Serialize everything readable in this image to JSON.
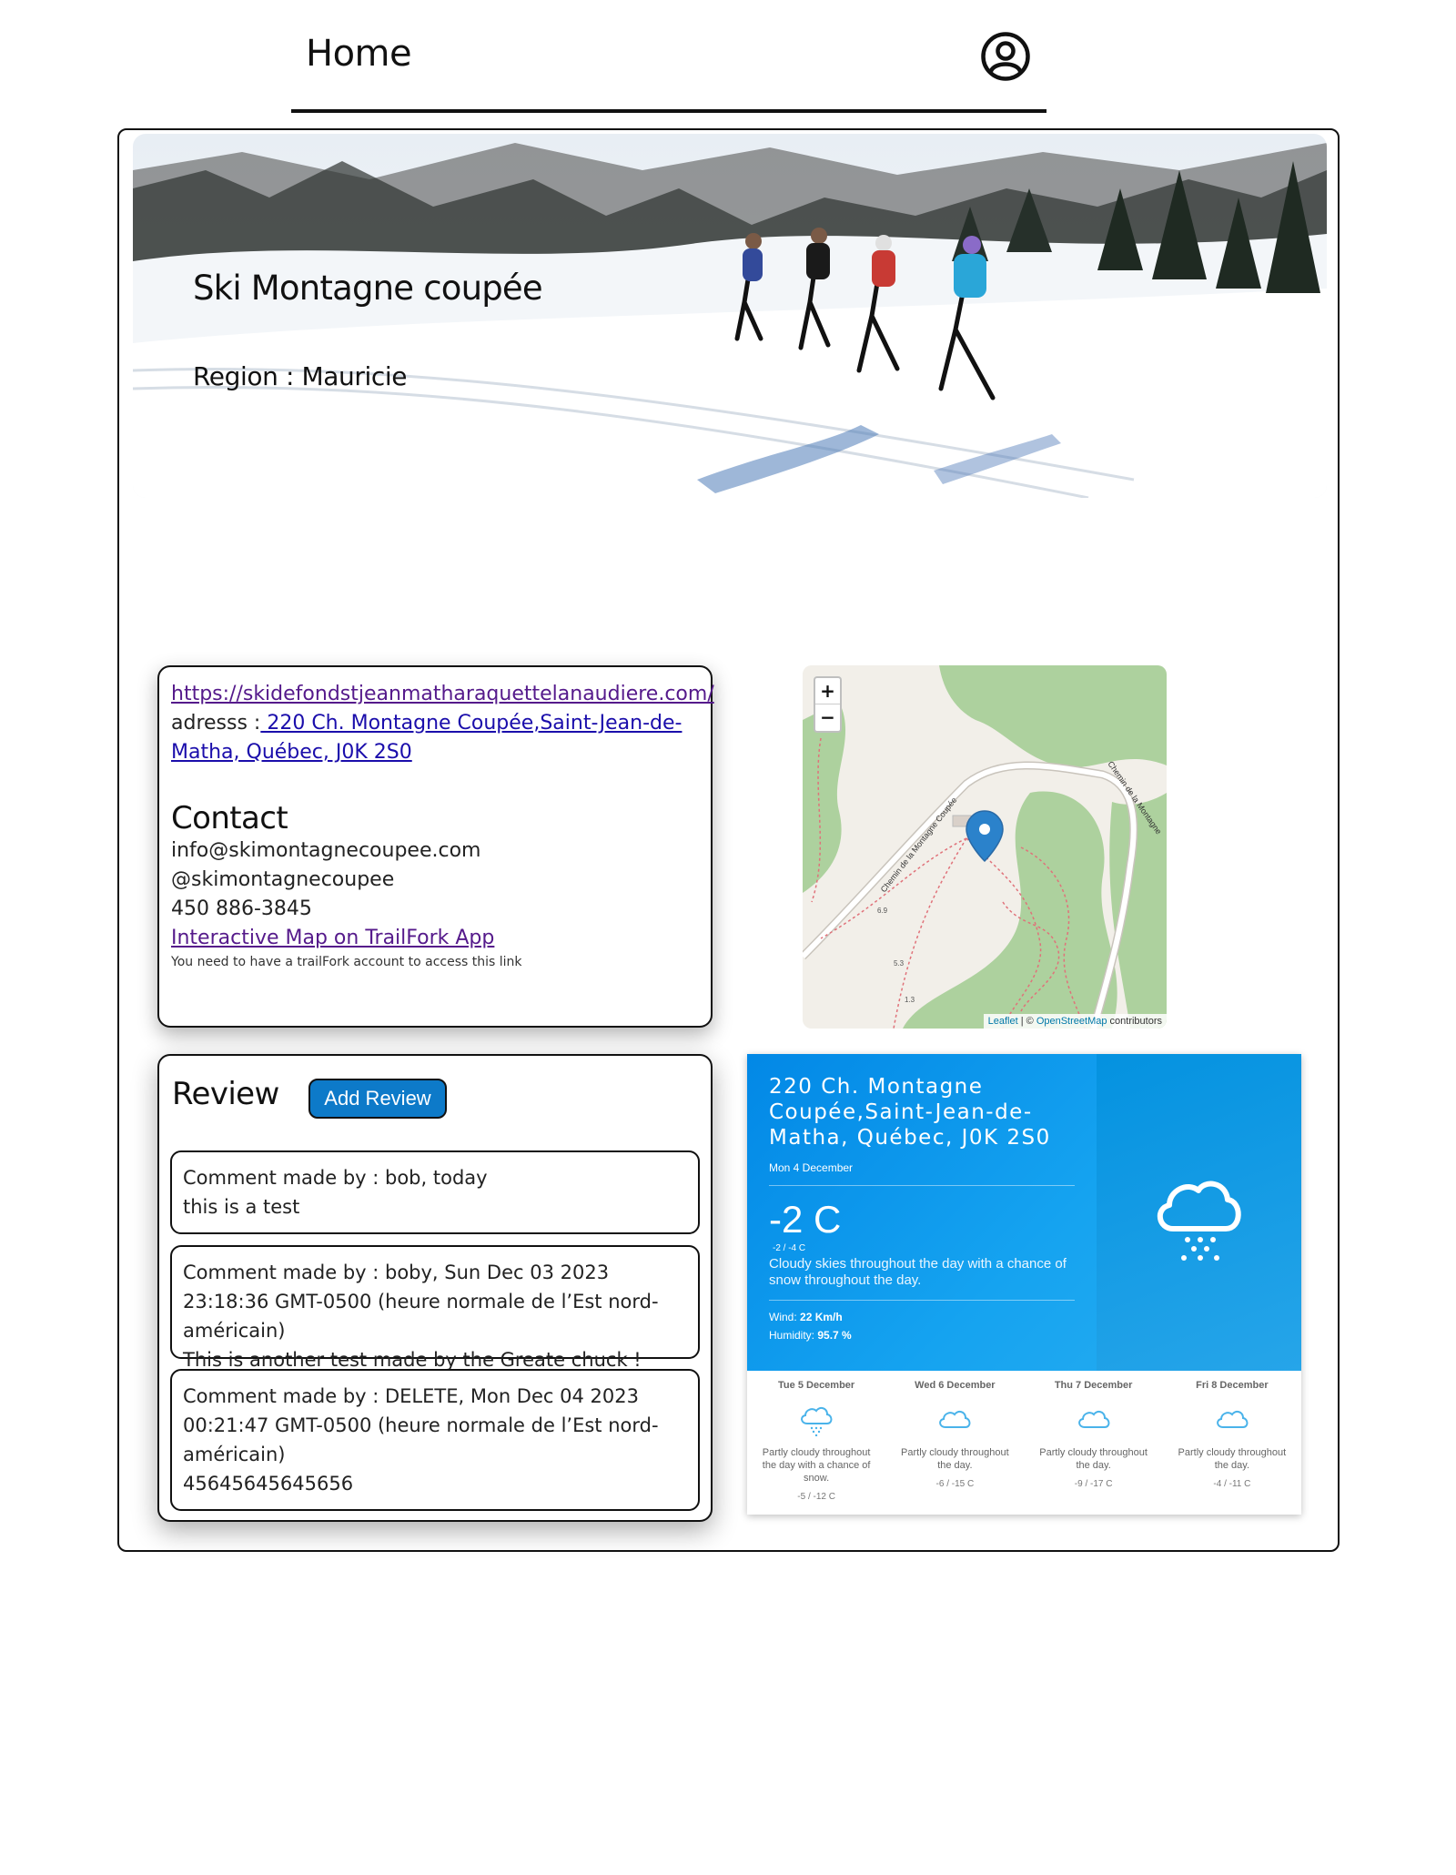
{
  "nav": {
    "home_label": "Home"
  },
  "hero": {
    "title": "Ski Montagne coupée",
    "region": "Region : Mauricie"
  },
  "info": {
    "website": "https://skidefondstjeanmatharaquettelanaudiere.com/",
    "address_label": "adresss :",
    "address": " 220 Ch. Montagne Coupée,Saint-Jean-de-Matha, Québec, J0K 2S0",
    "contact_title": "Contact",
    "email": "info@skimontagnecoupee.com",
    "social": "@skimontagnecoupee",
    "phone": "450 886-3845",
    "map_link": "Interactive Map on TrailFork App",
    "note": "You need to have a trailFork account to access this link"
  },
  "map": {
    "zoom_in": "+",
    "zoom_out": "−",
    "road_label_1": "Chemin de la Montagne Coupée",
    "road_label_2": "Chemin de la Montagne",
    "trail_1": "6.9",
    "trail_2": "5.3",
    "trail_3": "1.3",
    "attr_leaflet": "Leaflet",
    "attr_sep": " | © ",
    "attr_osm": "OpenStreetMap",
    "attr_contrib": " contributors"
  },
  "review": {
    "title": "Review",
    "add_button": "Add Review",
    "comments": [
      {
        "header": "Comment made by : bob, today",
        "body": "this is a test"
      },
      {
        "header": "Comment made by : boby, Sun Dec 03 2023 23:18:36 GMT-0500 (heure normale de l’Est nord-américain)",
        "body": "This is another test made by the Greate chuck !"
      },
      {
        "header": "Comment made by : DELETE, Mon Dec 04 2023 00:21:47 GMT-0500 (heure normale de l’Est nord-américain)",
        "body": "45645645645656"
      }
    ]
  },
  "weather": {
    "location": "220 Ch. Montagne Coupée,Saint-Jean-de-Matha, Québec, J0K 2S0",
    "date": "Mon 4 December",
    "temp": "-2 C",
    "range": "-2 / -4 C",
    "desc": "Cloudy skies throughout the day with a chance of snow throughout the day.",
    "wind_label": "Wind: ",
    "wind": "22 Km/h",
    "humidity_label": "Humidity: ",
    "humidity": "95.7 %",
    "days": [
      {
        "name": "Tue 5 December",
        "desc": "Partly cloudy throughout the day with a chance of snow.",
        "range": "-5 / -12 C",
        "icon": "snow-cloud-icon"
      },
      {
        "name": "Wed 6 December",
        "desc": "Partly cloudy throughout the day.",
        "range": "-6 / -15 C",
        "icon": "cloud-icon"
      },
      {
        "name": "Thu 7 December",
        "desc": "Partly cloudy throughout the day.",
        "range": "-9 / -17 C",
        "icon": "cloud-icon"
      },
      {
        "name": "Fri 8 December",
        "desc": "Partly cloudy throughout the day.",
        "range": "-4 / -11 C",
        "icon": "cloud-icon"
      }
    ],
    "colors": {
      "accent": "#0288e6",
      "text": "#ffffff"
    }
  },
  "colors": {
    "button": "#0d7ac9",
    "link_visited": "#551a8b",
    "link": "#1a0dab"
  }
}
